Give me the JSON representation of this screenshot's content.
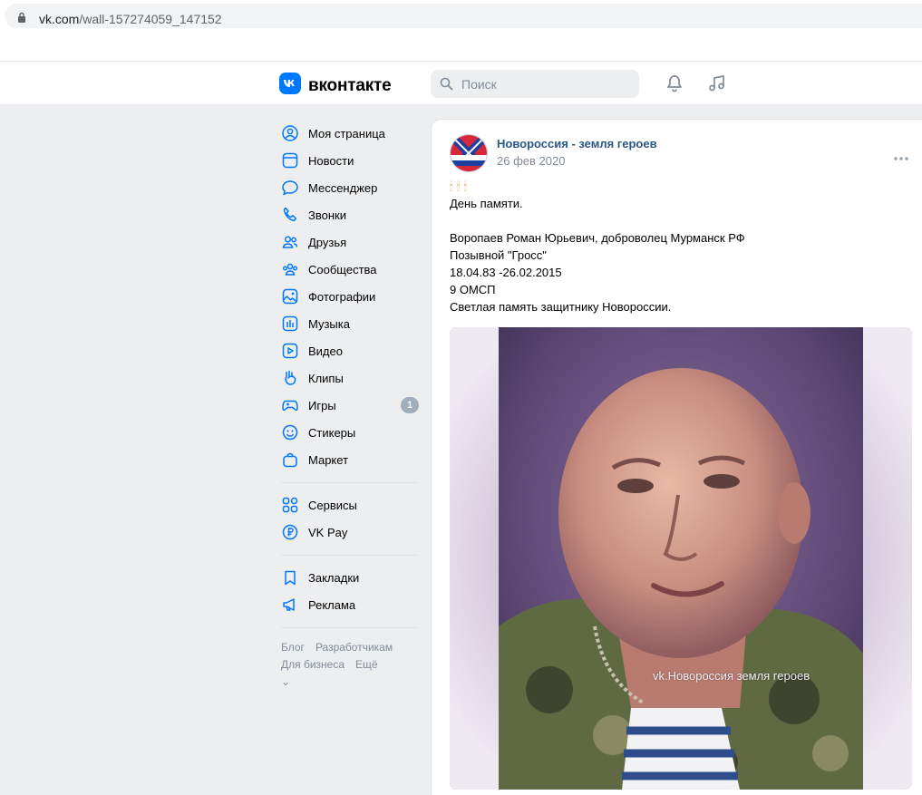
{
  "browser": {
    "url_host": "vk.com",
    "url_path": "/wall-157274059_147152"
  },
  "header": {
    "logo_text": "вконтакте",
    "search_placeholder": "Поиск",
    "icons": [
      "vk-logo-icon",
      "search-icon",
      "bell-icon",
      "music-icon"
    ]
  },
  "menu": {
    "items": [
      {
        "label": "Моя страница",
        "icon": "user-circle-icon"
      },
      {
        "label": "Новости",
        "icon": "news-icon"
      },
      {
        "label": "Мессенджер",
        "icon": "message-icon"
      },
      {
        "label": "Звонки",
        "icon": "phone-icon"
      },
      {
        "label": "Друзья",
        "icon": "friends-icon"
      },
      {
        "label": "Сообщества",
        "icon": "communities-icon"
      },
      {
        "label": "Фотографии",
        "icon": "photos-icon"
      },
      {
        "label": "Музыка",
        "icon": "music-icon"
      },
      {
        "label": "Видео",
        "icon": "video-icon"
      },
      {
        "label": "Клипы",
        "icon": "clips-icon"
      },
      {
        "label": "Игры",
        "icon": "games-icon",
        "badge": "1"
      },
      {
        "label": "Стикеры",
        "icon": "stickers-icon"
      },
      {
        "label": "Маркет",
        "icon": "market-icon"
      }
    ],
    "group2": [
      {
        "label": "Сервисы",
        "icon": "services-icon"
      },
      {
        "label": "VK Pay",
        "icon": "vkpay-icon"
      }
    ],
    "group3": [
      {
        "label": "Закладки",
        "icon": "bookmark-icon"
      },
      {
        "label": "Реклама",
        "icon": "megaphone-icon"
      }
    ],
    "footer": {
      "blog": "Блог",
      "developers": "Разработчикам",
      "business": "Для бизнеса",
      "more": "Ещё"
    }
  },
  "post": {
    "author": "Новороссия - земля героев",
    "date": "26 фев 2020",
    "candles": "🕯🕯🕯",
    "lines": [
      "День памяти.",
      "",
      "Воропаев Роман Юрьевич, доброволец Мурманск РФ",
      "Позывной \"Гросс\"",
      "18.04.83 -26.02.2015",
      "9 ОМСП",
      "Светлая память защитнику Новороссии."
    ],
    "photo_watermark": "vk.Новороссия земля героев"
  },
  "colors": {
    "vk_blue": "#0077ff",
    "link": "#2a5885",
    "muted": "#818c99",
    "page_bg": "#edeef0"
  }
}
